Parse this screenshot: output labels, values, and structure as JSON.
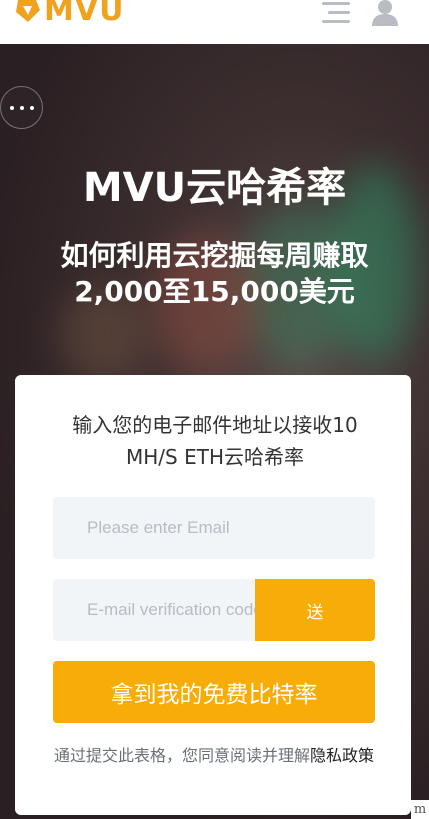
{
  "header": {
    "logo_text": "MVU",
    "brand_color": "#f0a21e",
    "menu_icon": "hamburger-menu-icon",
    "user_icon": "user-icon"
  },
  "more_button": {
    "icon": "more-dots-icon"
  },
  "hero": {
    "title": "MVU云哈希率",
    "subtitle_line1": "如何利用云挖掘每周赚取",
    "subtitle_line2": "2,000至15,000美元"
  },
  "form": {
    "description": "输入您的电子邮件地址以接收10 MH/S ETH云哈希率",
    "email_placeholder": "Please enter Email",
    "code_placeholder": "E-mail verification code",
    "send_label": "送",
    "submit_label": "拿到我的免费比特率",
    "agree_prefix": "通过提交此表格，您同意阅读并理解",
    "agree_link": "隐私政策",
    "accent_color": "#f8ac08"
  },
  "corner_mark": "m"
}
